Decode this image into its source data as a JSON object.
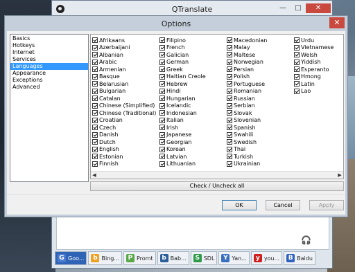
{
  "qtranslate": {
    "title": "QTranslate",
    "controls": {
      "minimize": "—",
      "maximize": "□",
      "close": "✕"
    },
    "tabs": [
      {
        "label": "Goo...",
        "icon": "google-translate-icon",
        "color": "#4a7bd0",
        "glyph": "G"
      },
      {
        "label": "Bing...",
        "icon": "bing-icon",
        "color": "#f0a020",
        "glyph": "b"
      },
      {
        "label": "Promt",
        "icon": "promt-icon",
        "color": "#5aa84a",
        "glyph": "P"
      },
      {
        "label": "Bab...",
        "icon": "babylon-icon",
        "color": "#2a5f9a",
        "glyph": "b"
      },
      {
        "label": "SDL",
        "icon": "sdl-icon",
        "color": "#2f9a4a",
        "glyph": "S"
      },
      {
        "label": "Yan...",
        "icon": "yandex-icon",
        "color": "#3a6fc0",
        "glyph": "Y"
      },
      {
        "label": "you...",
        "icon": "youdao-icon",
        "color": "#d02020",
        "glyph": "y"
      },
      {
        "label": "Baidu",
        "icon": "baidu-icon",
        "color": "#3060c0",
        "glyph": "B"
      }
    ]
  },
  "dialog": {
    "title": "Options",
    "close": "✕",
    "categories": [
      "Basics",
      "Hotkeys",
      "Internet",
      "Services",
      "Languages",
      "Appearance",
      "Exceptions",
      "Advanced"
    ],
    "selected_category": "Languages",
    "languages": [
      [
        "Afrikaans",
        "Azerbaijani",
        "Albanian",
        "Arabic",
        "Armenian",
        "Basque",
        "Belarusian",
        "Bulgarian",
        "Catalan",
        "Chinese (Simplified)",
        "Chinese (Traditional)",
        "Croatian",
        "Czech",
        "Danish",
        "Dutch",
        "English",
        "Estonian",
        "Finnish"
      ],
      [
        "Filipino",
        "French",
        "Galician",
        "German",
        "Greek",
        "Haitian Creole",
        "Hebrew",
        "Hindi",
        "Hungarian",
        "Icelandic",
        "Indonesian",
        "Italian",
        "Irish",
        "Japanese",
        "Georgian",
        "Korean",
        "Latvian",
        "Lithuanian"
      ],
      [
        "Macedonian",
        "Malay",
        "Maltese",
        "Norwegian",
        "Persian",
        "Polish",
        "Portuguese",
        "Romanian",
        "Russian",
        "Serbian",
        "Slovak",
        "Slovenian",
        "Spanish",
        "Swahili",
        "Swedish",
        "Thai",
        "Turkish",
        "Ukrainian"
      ],
      [
        "Urdu",
        "Vietnamese",
        "Welsh",
        "Yiddish",
        "Esperanto",
        "Hmong",
        "Latin",
        "Lao"
      ]
    ],
    "check_all_label": "Check / Uncheck all",
    "buttons": {
      "ok": "OK",
      "cancel": "Cancel",
      "apply": "Apply"
    }
  }
}
